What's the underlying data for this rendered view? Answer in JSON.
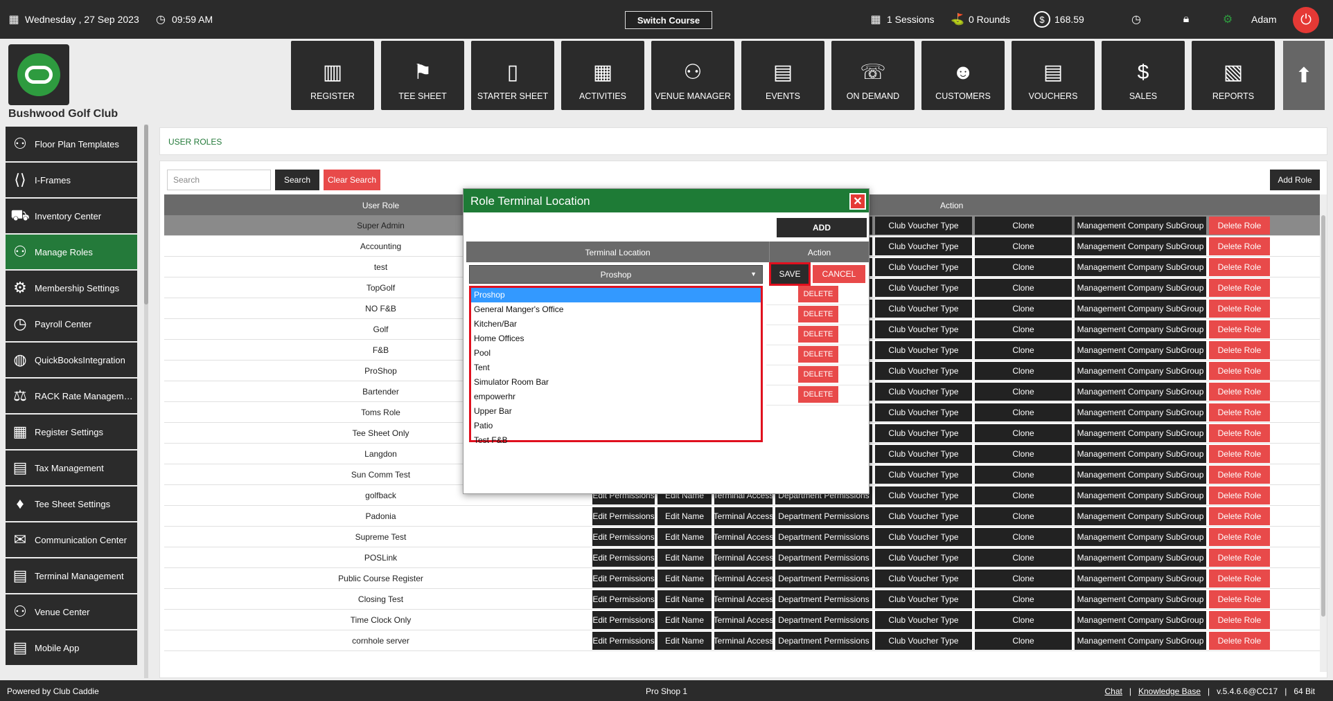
{
  "topbar": {
    "date": "Wednesday ,  27 Sep 2023",
    "time": "09:59 AM",
    "switch_course": "Switch Course",
    "sessions": "1 Sessions",
    "rounds": "0 Rounds",
    "balance": "168.59",
    "user": "Adam"
  },
  "club": {
    "name": "Bushwood Golf Club"
  },
  "nav": [
    {
      "label": "REGISTER",
      "icon": "barcode-scanner-icon",
      "glyph": "▥"
    },
    {
      "label": "TEE SHEET",
      "icon": "tee-sheet-icon",
      "glyph": "⚑"
    },
    {
      "label": "STARTER SHEET",
      "icon": "tablet-icon",
      "glyph": "▯"
    },
    {
      "label": "ACTIVITIES",
      "icon": "calendar-icon",
      "glyph": "▦"
    },
    {
      "label": "VENUE MANAGER",
      "icon": "venue-icon",
      "glyph": "⚇"
    },
    {
      "label": "EVENTS",
      "icon": "events-icon",
      "glyph": "▤"
    },
    {
      "label": "ON DEMAND",
      "icon": "mobile-icon",
      "glyph": "☏"
    },
    {
      "label": "CUSTOMERS",
      "icon": "customers-icon",
      "glyph": "☻"
    },
    {
      "label": "VOUCHERS",
      "icon": "vouchers-icon",
      "glyph": "▤"
    },
    {
      "label": "SALES",
      "icon": "sales-icon",
      "glyph": "$"
    },
    {
      "label": "REPORTS",
      "icon": "reports-icon",
      "glyph": "▧"
    }
  ],
  "sidebar": {
    "items": [
      {
        "label": "Floor Plan Templates",
        "icon": "floor-plan-icon",
        "glyph": "⚇"
      },
      {
        "label": "I-Frames",
        "icon": "code-icon",
        "glyph": "⟨⟩"
      },
      {
        "label": "Inventory Center",
        "icon": "inventory-icon",
        "glyph": "⛟"
      },
      {
        "label": "Manage Roles",
        "icon": "roles-icon",
        "glyph": "⚇"
      },
      {
        "label": "Membership Settings",
        "icon": "gear-icon",
        "glyph": "⚙"
      },
      {
        "label": "Payroll Center",
        "icon": "clock-icon",
        "glyph": "◷"
      },
      {
        "label": "QuickBooksIntegration",
        "icon": "quickbooks-icon",
        "glyph": "◍"
      },
      {
        "label": "RACK Rate Manageme...",
        "icon": "rate-icon",
        "glyph": "⚖"
      },
      {
        "label": "Register Settings",
        "icon": "register-settings-icon",
        "glyph": "▦"
      },
      {
        "label": "Tax Management",
        "icon": "tax-icon",
        "glyph": "▤"
      },
      {
        "label": "Tee Sheet Settings",
        "icon": "golf-tee-icon",
        "glyph": "♦"
      },
      {
        "label": "Communication Center",
        "icon": "communication-icon",
        "glyph": "✉"
      },
      {
        "label": "Terminal Management",
        "icon": "terminal-icon",
        "glyph": "▤"
      },
      {
        "label": "Venue Center",
        "icon": "venue-center-icon",
        "glyph": "⚇"
      },
      {
        "label": "Mobile App",
        "icon": "mobile-app-icon",
        "glyph": "▤"
      }
    ]
  },
  "page": {
    "title": "USER ROLES",
    "search_placeholder": "Search",
    "search_btn": "Search",
    "clear_btn": "Clear Search",
    "add_role_btn": "Add Role"
  },
  "table": {
    "headers": {
      "role": "User Role",
      "action": "Action"
    },
    "actions": {
      "edit_permissions": "Edit Permissions",
      "edit_name": "Edit Name",
      "terminal_access": "Terminal Access",
      "dept_permissions": "Department Permissions",
      "voucher_type": "Club Voucher Type",
      "clone": "Clone",
      "mgmt_subgroup": "Management Company SubGroup",
      "delete_role": "Delete Role"
    },
    "rows": [
      "Super Admin",
      "Accounting",
      "test",
      "TopGolf",
      "NO F&B",
      "Golf",
      "F&B",
      "ProShop",
      "Bartender",
      "Toms Role",
      "Tee Sheet Only",
      "Langdon",
      "Sun Comm Test",
      "golfback",
      "Padonia",
      "Supreme Test",
      "POSLink",
      "Public Course Register",
      "Closing Test",
      "Time Clock Only",
      "cornhole server"
    ]
  },
  "modal": {
    "title": "Role Terminal Location",
    "add_btn": "ADD",
    "col_location": "Terminal Location",
    "col_action": "Action",
    "selected": "Proshop",
    "save_btn": "SAVE",
    "cancel_btn": "CANCEL",
    "delete_btn": "DELETE",
    "options": [
      "Proshop",
      "General Manger's Office",
      "Kitchen/Bar",
      "Home Offices",
      "Pool",
      "Tent",
      "Simulator Room Bar",
      "empowerhr",
      "Upper Bar",
      "Patio",
      "Test F&B"
    ]
  },
  "footer": {
    "powered": "Powered by Club Caddie",
    "terminal": "Pro Shop 1",
    "chat": "Chat",
    "kb": "Knowledge Base",
    "version": "v.5.4.6.6@CC17",
    "bits": "64 Bit",
    "sep": "|"
  }
}
